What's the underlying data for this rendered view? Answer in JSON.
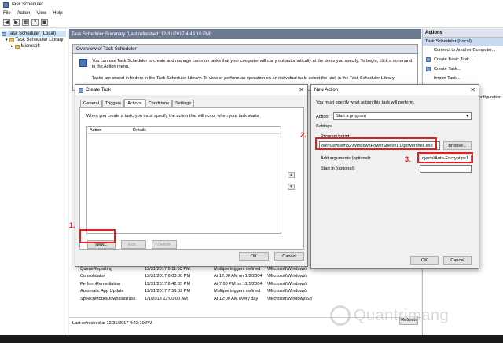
{
  "window": {
    "title": "Task Scheduler"
  },
  "menu": [
    "File",
    "Action",
    "View",
    "Help"
  ],
  "tree": {
    "root": "Task Scheduler (Local)",
    "library": "Task Scheduler Library",
    "child": "Microsoft"
  },
  "summary": {
    "header": "Task Scheduler Summary (Last refreshed: 12/31/2017 4:43:10 PM)",
    "overview_title": "Overview of Task Scheduler",
    "text1": "You can use Task Scheduler to create and manage common tasks that your computer will carry out automatically at the times you specify. To begin, click a command in the Action menu.",
    "text2": "Tasks are stored in folders in the Task Scheduler Library. To view or perform an operation on an individual task, select the task in the Task Scheduler Library"
  },
  "actions_pane": {
    "header": "Actions",
    "selected": "Task Scheduler (Local)",
    "items": [
      "Connect to Another Computer...",
      "Create Basic Task...",
      "Create Task...",
      "Import Task...",
      "",
      "Configuration"
    ]
  },
  "task_rows": [
    [
      "QueueReporting",
      "12/31/2017 5:11:53 PM",
      "Multiple triggers defined",
      "\\Microsoft\\Windows\\"
    ],
    [
      "Consolidator",
      "12/31/2017 6:00:00 PM",
      "At 12:00 AM on 1/2/2004",
      "\\Microsoft\\Windows\\"
    ],
    [
      "PerformRemediation",
      "12/31/2017 6:42:05 PM",
      "At 7:00 PM on 11/1/2004",
      "\\Microsoft\\Windows\\"
    ],
    [
      "Automatic App Update",
      "12/31/2017 7:56:52 PM",
      "Multiple triggers defined",
      "\\Microsoft\\Windows\\"
    ],
    [
      "SpeechModelDownloadTask",
      "1/1/2018 12:00:00 AM",
      "At 12:00 AM every day",
      "\\Microsoft\\Windows\\Sp"
    ]
  ],
  "status": {
    "last_refreshed": "Last refreshed at 12/31/2017 4:43:10 PM",
    "refresh_label": "Refresh"
  },
  "create_task": {
    "title": "Create Task",
    "tabs": [
      "General",
      "Triggers",
      "Actions",
      "Conditions",
      "Settings"
    ],
    "hint": "When you create a task, you must specify the action that will occur when your task starts.",
    "col_action": "Action",
    "col_details": "Details",
    "new_label": "New...",
    "edit_label": "Edit...",
    "delete_label": "Delete",
    "ok_label": "OK",
    "cancel_label": "Cancel"
  },
  "new_action": {
    "title": "New Action",
    "instruction": "You must specify what action this task will perform.",
    "action_label": "Action:",
    "action_value": "Start a program",
    "settings_label": "Settings",
    "program_label": "Program/script:",
    "program_value": "oot%\\system32\\WindowsPowerShell\\v1.0\\powershell.exe",
    "browse_label": "Browse...",
    "args_label": "Add arguments (optional):",
    "args_value": "ojects\\Auto-Encrypt.ps1",
    "startin_label": "Start in (optional):",
    "ok_label": "OK",
    "cancel_label": "Cancel"
  },
  "callouts": {
    "one": "1.",
    "two": "2.",
    "three": "3."
  },
  "watermark": "Quantrimang",
  "colors": {
    "callout_red": "#e02020",
    "header_bg": "#6b7a8f",
    "selected_bg": "#c9d9ef"
  }
}
